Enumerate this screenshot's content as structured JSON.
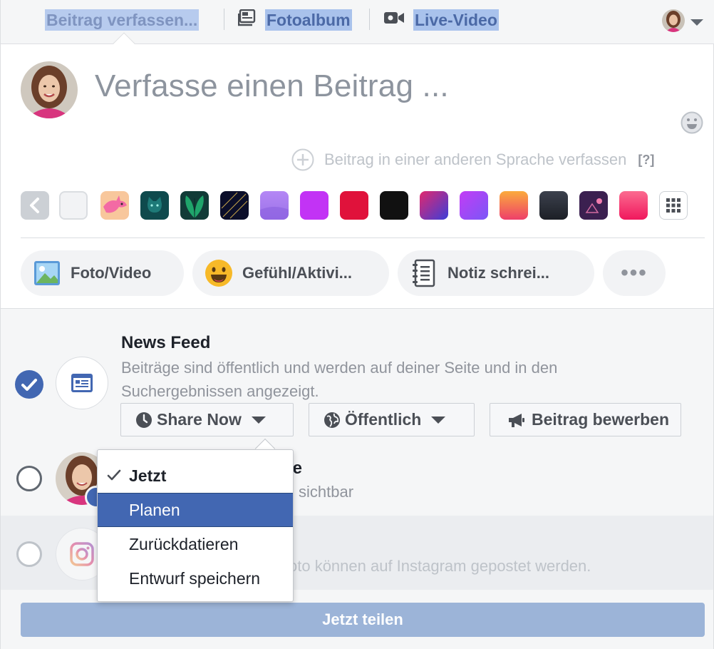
{
  "tabs": {
    "compose": "Beitrag verfassen...",
    "album": "Fotoalbum",
    "live": "Live-Video"
  },
  "composer": {
    "placeholder": "Verfasse einen Beitrag ...",
    "other_language": "Beitrag in einer anderen Sprache verfassen",
    "help": "[?]"
  },
  "backgrounds": {
    "colors": [
      "#f2f3f5",
      "#f8c79c",
      "#0f4a4d",
      "#113b37",
      "#0b0e2a",
      "#a880f0",
      "#c233f5",
      "#e0123b",
      "#111111",
      "#7b2bc0",
      "#8b4df5",
      "#f7833a",
      "#2a2e38",
      "#3b2050",
      "#f4327a"
    ]
  },
  "actions": {
    "photo": "Foto/Video",
    "feeling": "Gefühl/Aktivi...",
    "note": "Notiz schrei...",
    "more": "•••"
  },
  "audience": {
    "news_feed_title": "News Feed",
    "news_feed_desc": "Beiträge sind öffentlich und werden auf deiner Seite und in den Suchergebnissen angezeigt.",
    "share_now": "Share Now",
    "public": "Öffentlich",
    "promote": "Beitrag bewerben",
    "story_title_partial": "ite",
    "story_desc_partial": "sichtbar",
    "instagram_desc_partial": "oto können auf Instagram gepostet werden.",
    "share_button": "Jetzt teilen"
  },
  "menu": {
    "items": [
      "Jetzt",
      "Planen",
      "Zurückdatieren",
      "Entwurf speichern"
    ],
    "selected": "Jetzt",
    "highlighted": "Planen"
  },
  "colors": {
    "brand": "#4267b2",
    "disabled_button": "#9cb4d8"
  }
}
